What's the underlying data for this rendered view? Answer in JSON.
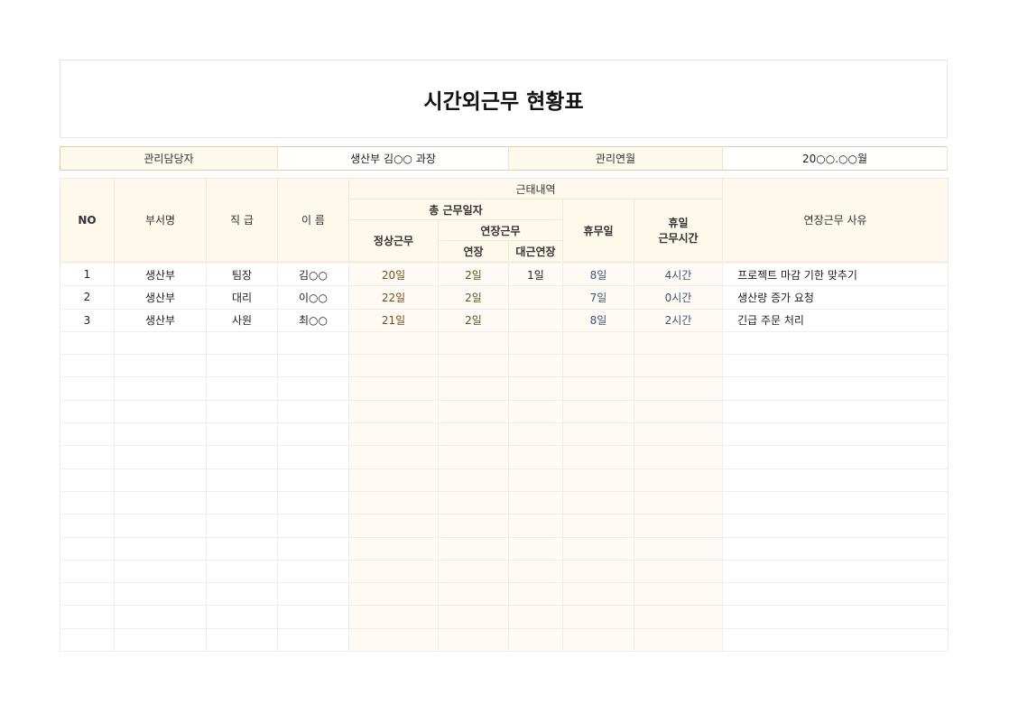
{
  "title": "시간외근무 현황표",
  "info": {
    "manager_label": "관리담당자",
    "manager_value": "생산부 김○○ 과장",
    "period_label": "관리연월",
    "period_value": "20○○.○○월"
  },
  "headers": {
    "no": "NO",
    "dept": "부서명",
    "rank": "직 급",
    "name": "이 름",
    "attendance": "근태내역",
    "total_days": "총 근무일자",
    "regular": "정상근무",
    "overtime": "연장근무",
    "extension": "연장",
    "substitute": "대근연장",
    "days_off": "휴무일",
    "holiday_hours": "휴일\n근무시간",
    "reason": "연장근무 사유"
  },
  "rows": [
    {
      "no": "1",
      "dept": "생산부",
      "rank": "팀장",
      "name": "김○○",
      "regular": "20일",
      "extension": "2일",
      "substitute": "1일",
      "days_off": "8일",
      "holiday_hours": "4시간",
      "reason": "프로젝트 마감 기한 맞추기"
    },
    {
      "no": "2",
      "dept": "생산부",
      "rank": "대리",
      "name": "이○○",
      "regular": "22일",
      "extension": "2일",
      "substitute": "",
      "days_off": "7일",
      "holiday_hours": "0시간",
      "reason": "생산량 증가 요청"
    },
    {
      "no": "3",
      "dept": "생산부",
      "rank": "사원",
      "name": "최○○",
      "regular": "21일",
      "extension": "2일",
      "substitute": "",
      "days_off": "8일",
      "holiday_hours": "2시간",
      "reason": "긴급 주문 처리"
    }
  ],
  "empty_rows": 14
}
